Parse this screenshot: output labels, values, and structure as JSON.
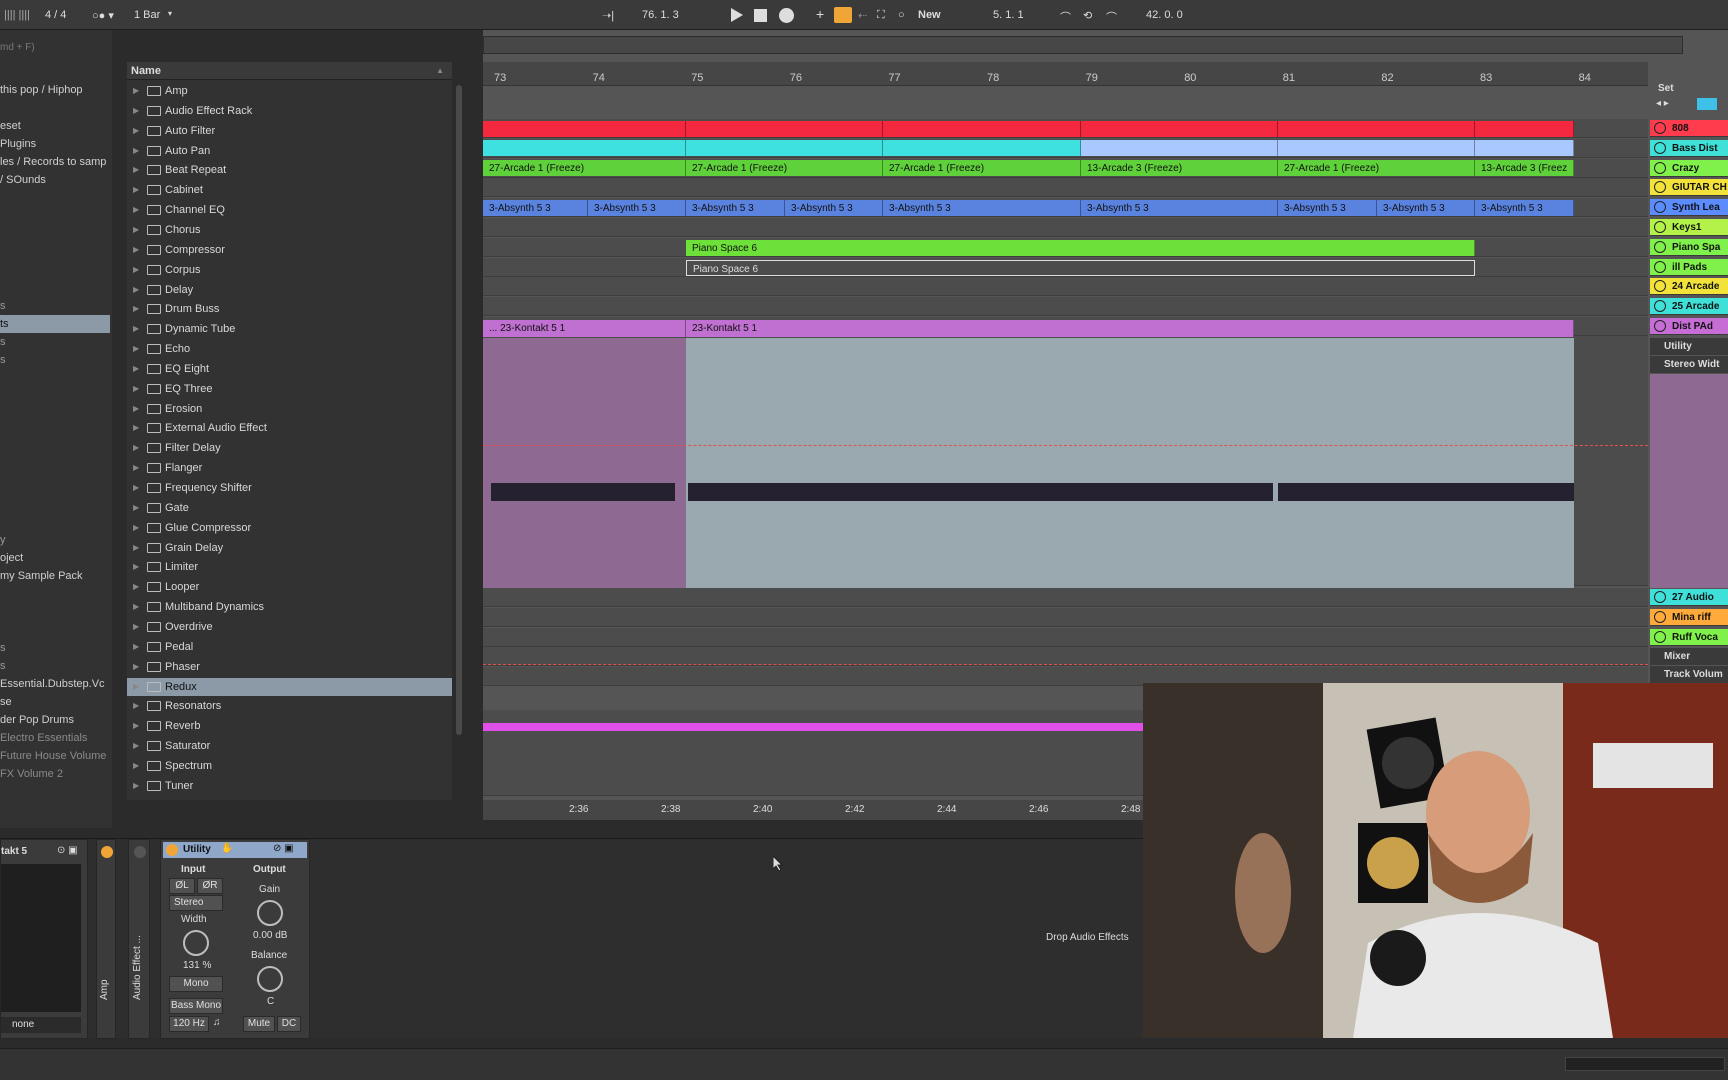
{
  "transport": {
    "time_sig": "4 / 4",
    "quantize": "1 Bar",
    "position": "76.   1.   3",
    "new_label": "New",
    "loop_start": "5.   1.   1",
    "loop_length": "42.   0.   0"
  },
  "places": {
    "search_hint": "md + F)",
    "items": [
      "this pop / Hiphop",
      "",
      "eset",
      "Plugins",
      "les / Records to samp",
      "/ SOunds",
      "",
      "",
      "",
      "",
      "ts",
      "s",
      "",
      "",
      "",
      "",
      "",
      "",
      "y",
      "oject",
      "my Sample Pack",
      "",
      "",
      "Essential.Dubstep.Vc",
      "se",
      "der Pop Drums",
      "Electro Essentials",
      "Future House Volume",
      "FX Volume 2"
    ]
  },
  "browser": {
    "header": "Name",
    "items": [
      "Amp",
      "Audio Effect Rack",
      "Auto Filter",
      "Auto Pan",
      "Beat Repeat",
      "Cabinet",
      "Channel EQ",
      "Chorus",
      "Compressor",
      "Corpus",
      "Delay",
      "Drum Buss",
      "Dynamic Tube",
      "Echo",
      "EQ Eight",
      "EQ Three",
      "Erosion",
      "External Audio Effect",
      "Filter Delay",
      "Flanger",
      "Frequency Shifter",
      "Gate",
      "Glue Compressor",
      "Grain Delay",
      "Limiter",
      "Looper",
      "Multiband Dynamics",
      "Overdrive",
      "Pedal",
      "Phaser",
      "Redux",
      "Resonators",
      "Reverb",
      "Saturator",
      "Spectrum",
      "Tuner"
    ],
    "selected": "Redux"
  },
  "ruler": {
    "bars": [
      "73",
      "74",
      "75",
      "76",
      "77",
      "78",
      "79",
      "80",
      "81",
      "82",
      "83",
      "84"
    ],
    "times": [
      "2:36",
      "2:38",
      "2:40",
      "2:42",
      "2:44",
      "2:46",
      "2:48"
    ]
  },
  "clips": {
    "arcade": [
      "27-Arcade 1 (Freeze)",
      "27-Arcade 1 (Freeze)",
      "27-Arcade 1 (Freeze)",
      "13-Arcade 3 (Freeze)",
      "27-Arcade 1 (Freeze)",
      "13-Arcade 3 (Freez"
    ],
    "absynth": [
      "3-Absynth 5 3",
      "3-Absynth 5 3",
      "3-Absynth 5 3",
      "3-Absynth 5 3",
      "3-Absynth 5 3",
      "3-Absynth 5 3",
      "3-Absynth 5 3",
      "3-Absynth 5 3",
      "3-Absynth 5 3"
    ],
    "piano1": "Piano Space 6",
    "piano2": "Piano Space 6",
    "kontakt_a": "... 23-Kontakt 5 1",
    "kontakt_b": "23-Kontakt 5 1"
  },
  "tracks": {
    "set_label": "Set",
    "names": [
      "808",
      "Bass Dist",
      "Crazy",
      "GIUTAR CH",
      "Synth Lea",
      "Keys1",
      "Piano Spa",
      "ill Pads",
      "24 Arcade",
      "25 Arcade",
      "Dist PAd"
    ],
    "dist_sub": [
      "Utility",
      "Stereo Widt"
    ],
    "lower": [
      "27 Audio",
      "Mina riff",
      "Ruff Voca"
    ],
    "ruff_sub": [
      "Mixer",
      "Track Volum"
    ],
    "colors": [
      "#ff3b4e",
      "#3ee0d8",
      "#7ff14a",
      "#f2e23a",
      "#5b8cff",
      "#b4f24a",
      "#7ff14a",
      "#7ff14a",
      "#f2e23a",
      "#3ee0d8",
      "#c76dd6",
      "#3ee0d8",
      "#ffaa3b",
      "#7ff14a"
    ]
  },
  "devices": {
    "kontakt_title": "takt 5",
    "kontakt_out": "none",
    "rack_label": "Audio Effect ...",
    "amp_label": "Amp",
    "utility_title": "Utility",
    "input_label": "Input",
    "output_label": "Output",
    "phase_l": "ØL",
    "phase_r": "ØR",
    "channel_mode": "Stereo",
    "gain_label": "Gain",
    "gain_value": "0.00 dB",
    "width_label": "Width",
    "width_value": "131 %",
    "balance_label": "Balance",
    "balance_value": "C",
    "mono_label": "Mono",
    "bass_mono_label": "Bass Mono",
    "bass_mono_freq": "120 Hz",
    "mute_label": "Mute",
    "dc_label": "DC",
    "drop_hint": "Drop Audio Effects"
  }
}
